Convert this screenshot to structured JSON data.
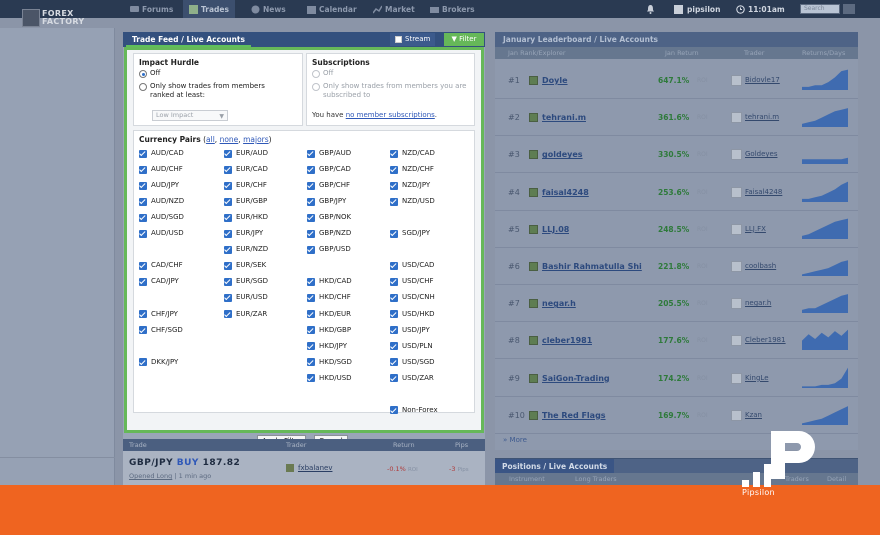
{
  "nav": {
    "logo": [
      "FOREX",
      "FACTORY"
    ],
    "items": [
      "Forums",
      "Trades",
      "News",
      "Calendar",
      "Market",
      "Brokers"
    ],
    "username": "pipsilon",
    "time": "11:01am",
    "search_placeholder": "Search"
  },
  "feed": {
    "title": "Trade Feed / Live Accounts",
    "stream_label": "Stream",
    "filter_label": "Filter",
    "impact": {
      "heading": "Impact Hurdle",
      "off_label": "Off",
      "ranked_label": "Only show trades from members ranked at least:",
      "select_value": "Low Impact"
    },
    "subs": {
      "heading": "Subscriptions",
      "off_label": "Off",
      "subscribed_label": "Only show trades from members you are subscribed to",
      "note_pre": "You have",
      "note_link": "no member subscriptions",
      "note_post": "."
    },
    "pairs": {
      "heading": "Currency Pairs",
      "open": "(",
      "all": "all",
      "sep1": ",",
      "none": "none",
      "sep2": ",",
      "majors": "majors",
      "close": ")",
      "col1": [
        "AUD/CAD",
        "AUD/CHF",
        "AUD/JPY",
        "AUD/NZD",
        "AUD/SGD",
        "AUD/USD",
        "CAD/CHF",
        "CAD/JPY",
        "CHF/JPY",
        "CHF/SGD",
        "DKK/JPY"
      ],
      "col2": [
        "EUR/AUD",
        "EUR/CAD",
        "EUR/CHF",
        "EUR/GBP",
        "EUR/HKD",
        "EUR/JPY",
        "EUR/NZD",
        "EUR/SEK",
        "EUR/SGD",
        "EUR/USD",
        "EUR/ZAR"
      ],
      "col3": [
        "GBP/AUD",
        "GBP/CAD",
        "GBP/CHF",
        "GBP/JPY",
        "GBP/NOK",
        "GBP/NZD",
        "GBP/USD",
        "HKD/CAD",
        "HKD/CHF",
        "HKD/EUR",
        "HKD/GBP",
        "HKD/JPY",
        "HKD/SGD",
        "HKD/USD"
      ],
      "col4": [
        "NZD/CAD",
        "NZD/CHF",
        "NZD/JPY",
        "NZD/USD",
        "SGD/JPY",
        "USD/CAD",
        "USD/CHF",
        "USD/CNH",
        "USD/HKD",
        "USD/JPY",
        "USD/PLN",
        "USD/SGD",
        "USD/ZAR",
        "Non-Forex"
      ]
    },
    "apply_label": "Apply Filter",
    "cancel_label": "Cancel",
    "table": {
      "cols": [
        "Trade",
        "Trader",
        "Return",
        "Pips"
      ],
      "row": {
        "pair": "GBP/JPY",
        "side": "BUY",
        "price": "187.82",
        "status": "Opened Long",
        "ago": "1 min ago",
        "sep": "|",
        "trader": "fxbalanev",
        "return": "-0.1%",
        "return_unit": "ROI",
        "pips": "-3",
        "pips_unit": "Pips"
      }
    }
  },
  "leaderboard": {
    "title": "January Leaderboard / Live Accounts",
    "cols": [
      "Jan Rank/Explorer",
      "Jan Return",
      "Trader",
      "Returns/Days"
    ],
    "roi_label": "ROI",
    "more": "More",
    "rows": [
      {
        "rank": "#1",
        "name": "Doyle",
        "pct": "647.1%",
        "trader": "Bidovle17",
        "spark": [
          2,
          2,
          3,
          3,
          5,
          8,
          12,
          13
        ]
      },
      {
        "rank": "#2",
        "name": "tehrani.m",
        "pct": "361.6%",
        "trader": "tehrani.m",
        "spark": [
          2,
          3,
          4,
          6,
          8,
          10,
          11,
          12
        ]
      },
      {
        "rank": "#3",
        "name": "goldeyes",
        "pct": "330.5%",
        "trader": "Goldeyes",
        "spark": [
          3,
          3,
          3,
          3,
          3,
          3,
          3,
          4
        ]
      },
      {
        "rank": "#4",
        "name": "faisal4248",
        "pct": "253.6%",
        "trader": "Faisal4248",
        "spark": [
          2,
          2,
          3,
          4,
          6,
          8,
          11,
          13
        ]
      },
      {
        "rank": "#5",
        "name": "LLJ.08",
        "pct": "248.5%",
        "trader": "LLJ.FX",
        "spark": [
          2,
          3,
          5,
          7,
          9,
          11,
          12,
          13
        ]
      },
      {
        "rank": "#6",
        "name": "Bashir Rahmatulla Shi",
        "pct": "221.8%",
        "trader": "coolbash",
        "spark": [
          1,
          2,
          3,
          4,
          5,
          7,
          9,
          10
        ]
      },
      {
        "rank": "#7",
        "name": "negar.h",
        "pct": "205.5%",
        "trader": "negar.h",
        "spark": [
          2,
          3,
          3,
          5,
          7,
          9,
          11,
          12
        ]
      },
      {
        "rank": "#8",
        "name": "cleber1981",
        "pct": "177.6%",
        "trader": "Cleber1981",
        "spark": [
          6,
          10,
          7,
          11,
          8,
          12,
          9,
          13
        ]
      },
      {
        "rank": "#9",
        "name": "SaiGon-Trading",
        "pct": "174.2%",
        "trader": "KingLe",
        "spark": [
          1,
          1,
          1,
          2,
          2,
          3,
          6,
          13
        ]
      },
      {
        "rank": "#10",
        "name": "The Red Flags",
        "pct": "169.7%",
        "trader": "Kzan",
        "spark": [
          1,
          2,
          3,
          4,
          6,
          8,
          10,
          12
        ]
      }
    ]
  },
  "positions": {
    "title": "Positions / Live Accounts",
    "cols": [
      "Instrument",
      "Long Traders",
      "Traders",
      "Detail"
    ]
  },
  "watermark": {
    "name": "Pipsilon"
  }
}
